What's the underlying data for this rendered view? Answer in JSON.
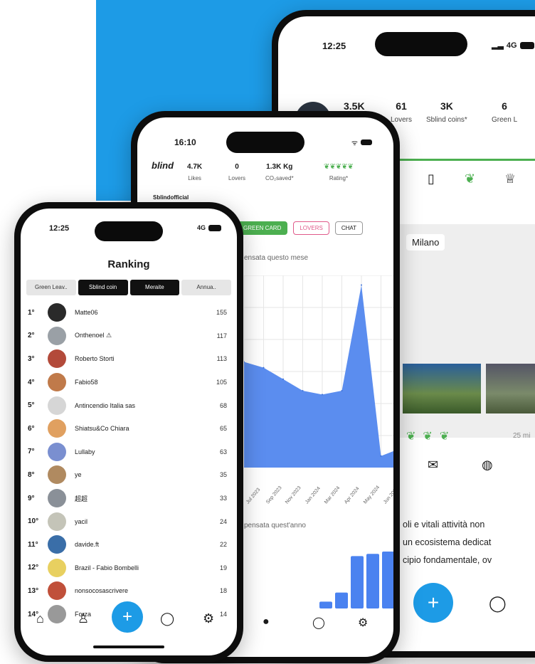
{
  "phone_back": {
    "time": "12:25",
    "signal": "4G",
    "stats": [
      {
        "num": "3.5K",
        "label": ""
      },
      {
        "num": "61",
        "label": "Lovers"
      },
      {
        "num": "3K",
        "label": "Sblind coins*"
      },
      {
        "num": "6",
        "label": "Green L"
      }
    ],
    "location_tag": "Milano",
    "post_text_lines": [
      "oli e vitali attività non",
      "un ecosistema dedicat",
      "cipio fondamentale, ov"
    ],
    "post_age": "25 mi"
  },
  "phone_mid": {
    "time": "16:10",
    "logo": "blind",
    "stats": [
      {
        "num": "4.7K",
        "label": "Likes"
      },
      {
        "num": "0",
        "label": "Lovers"
      },
      {
        "num": "1.3K Kg",
        "label": "CO₂saved*"
      },
      {
        "num": "",
        "label": "Rating*"
      }
    ],
    "handle": "Sblindofficial",
    "buttons": [
      "GREEN CARD",
      "LOVERS",
      "CHAT"
    ],
    "month_caption": "ensata questo mese",
    "year_caption": "pensata quest'anno",
    "chart_data": {
      "type": "area",
      "x": [
        "Jul 2023",
        "Sep 2023",
        "Nov 2023",
        "Jan 2024",
        "Mar 2024",
        "Apr 2024",
        "May 2024",
        "Jun 2024",
        "Jul 2024"
      ],
      "values": [
        55,
        52,
        46,
        40,
        38,
        40,
        95,
        6,
        10
      ]
    },
    "bar_data": {
      "type": "bar",
      "values": [
        6,
        14,
        46,
        48,
        50
      ]
    }
  },
  "phone_front": {
    "time": "12:25",
    "signal": "4G",
    "title": "Ranking",
    "tabs": [
      "Green Leav..",
      "Sblind coin",
      "Meraite",
      "Annua.."
    ],
    "active_tabs": [
      1,
      2
    ],
    "rows": [
      {
        "rank": "1°",
        "name": "Matte06",
        "score": "155",
        "color": "#2a2a2a"
      },
      {
        "rank": "2°",
        "name": "Onthenoel ⚠",
        "score": "117",
        "color": "#9aa0a6"
      },
      {
        "rank": "3°",
        "name": "Roberto Storti",
        "score": "113",
        "color": "#b34a3a"
      },
      {
        "rank": "4°",
        "name": "Fabio58",
        "score": "105",
        "color": "#c07a4a"
      },
      {
        "rank": "5°",
        "name": "Antincendio Italia sas",
        "score": "68",
        "color": "#d6d6d6"
      },
      {
        "rank": "6°",
        "name": "Shiatsu&Co Chiara",
        "score": "65",
        "color": "#e0a060"
      },
      {
        "rank": "7°",
        "name": "Lullaby",
        "score": "63",
        "color": "#7a8fd0"
      },
      {
        "rank": "8°",
        "name": "ye",
        "score": "35",
        "color": "#b08a60"
      },
      {
        "rank": "9°",
        "name": "超超",
        "score": "33",
        "color": "#8a9098"
      },
      {
        "rank": "10°",
        "name": "yacil",
        "score": "24",
        "color": "#c4c4b8"
      },
      {
        "rank": "11°",
        "name": "davide.ft",
        "score": "22",
        "color": "#3a6ea8"
      },
      {
        "rank": "12°",
        "name": "Brazil - Fabio Bombelli",
        "score": "19",
        "color": "#e8d060"
      },
      {
        "rank": "13°",
        "name": "nonsocosascrivere",
        "score": "18",
        "color": "#c0503a"
      },
      {
        "rank": "14°",
        "name": "Forza",
        "score": "14",
        "color": "#999999"
      }
    ]
  }
}
